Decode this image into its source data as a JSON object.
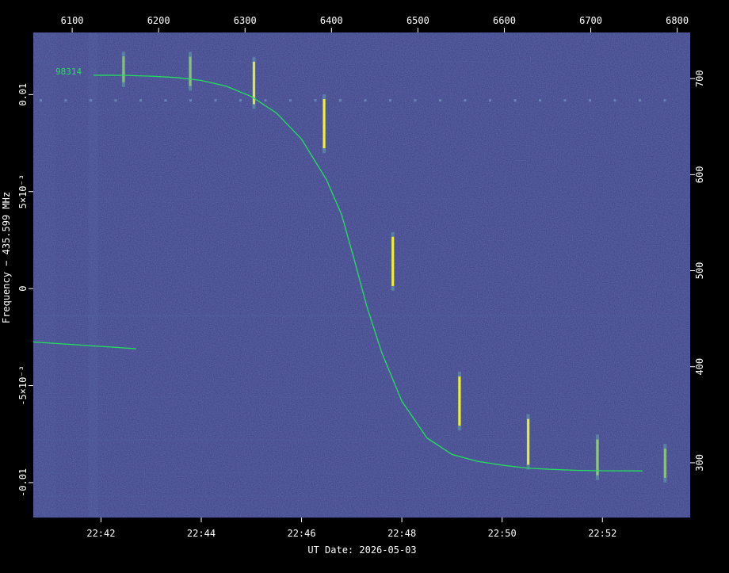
{
  "chart_data": {
    "type": "scatter",
    "title": "",
    "object_id": "98314",
    "xlabel": "UT Date: 2026-05-03",
    "ylabel": "Frequency − 435.599 MHz",
    "x_ticks_bottom": [
      "22:42",
      "22:44",
      "22:46",
      "22:48",
      "22:50",
      "22:52"
    ],
    "x_ticks_top": [
      "6100",
      "6200",
      "6300",
      "6400",
      "6500",
      "6600",
      "6700",
      "6800"
    ],
    "y_ticks_left": [
      "-0.01",
      "-5×10⁻³",
      "0",
      "5×10⁻³",
      "0.01"
    ],
    "y_ticks_right": [
      "300",
      "400",
      "500",
      "600",
      "700"
    ],
    "xlim_minutes_bottom": [
      40.65,
      53.75
    ],
    "xlim_top": [
      6055,
      6815
    ],
    "ylim_mhz": [
      -0.0118,
      0.0132
    ],
    "ylim_right": [
      243,
      748
    ],
    "series": [
      {
        "kind": "doppler_fit_curve",
        "color": "#22e05a",
        "points_minute_offset": [
          [
            41.85,
            0.011
          ],
          [
            42.5,
            0.01099
          ],
          [
            43.0,
            0.01095
          ],
          [
            43.5,
            0.01088
          ],
          [
            44.0,
            0.01073
          ],
          [
            44.5,
            0.01043
          ],
          [
            45.0,
            0.0099
          ],
          [
            45.5,
            0.00905
          ],
          [
            46.0,
            0.0077
          ],
          [
            46.5,
            0.0056
          ],
          [
            46.8,
            0.0038
          ],
          [
            47.05,
            0.0015
          ],
          [
            47.3,
            -0.0009
          ],
          [
            47.6,
            -0.0033
          ],
          [
            48.0,
            -0.0058
          ],
          [
            48.5,
            -0.0077
          ],
          [
            49.0,
            -0.00855
          ],
          [
            49.5,
            -0.0089
          ],
          [
            50.0,
            -0.0091
          ],
          [
            50.5,
            -0.00925
          ],
          [
            51.0,
            -0.00932
          ],
          [
            51.5,
            -0.00937
          ],
          [
            52.0,
            -0.00939
          ],
          [
            52.8,
            -0.0094
          ]
        ]
      },
      {
        "kind": "secondary_fit_line",
        "color": "#22e05a",
        "points_minute_offset": [
          [
            40.65,
            -0.00275
          ],
          [
            42.7,
            -0.0031
          ]
        ]
      }
    ],
    "detections": [
      {
        "t_min": 42.45,
        "f_mhz": 0.0113,
        "intensity": 0.3
      },
      {
        "t_min": 43.78,
        "f_mhz": 0.0112,
        "intensity": 0.4
      },
      {
        "t_min": 45.05,
        "f_mhz": 0.0106,
        "intensity": 0.8
      },
      {
        "t_min": 46.45,
        "f_mhz": 0.0085,
        "intensity": 1.0
      },
      {
        "t_min": 47.82,
        "f_mhz": 0.0014,
        "intensity": 1.0
      },
      {
        "t_min": 49.15,
        "f_mhz": -0.0058,
        "intensity": 1.0
      },
      {
        "t_min": 50.52,
        "f_mhz": -0.0079,
        "intensity": 0.9
      },
      {
        "t_min": 51.9,
        "f_mhz": -0.0087,
        "intensity": 0.6
      },
      {
        "t_min": 53.25,
        "f_mhz": -0.009,
        "intensity": 0.4
      }
    ],
    "background_colormap": "viridis-dark",
    "colors": {
      "background": "#3a3f86",
      "curve": "#22e05a",
      "bright": "#f5ee2a",
      "frame": "#000000"
    },
    "grid": false,
    "legend": "none"
  }
}
